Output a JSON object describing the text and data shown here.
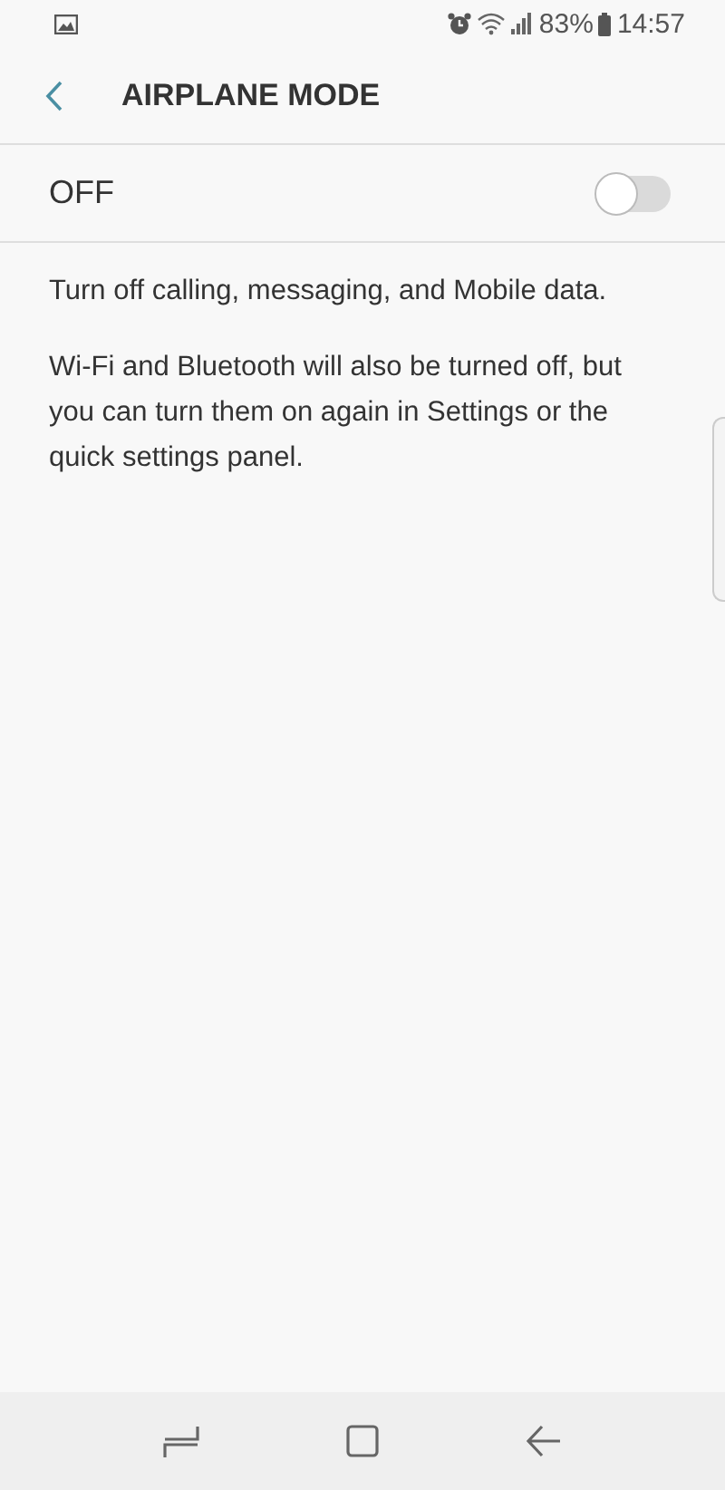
{
  "status_bar": {
    "battery": "83%",
    "time": "14:57"
  },
  "header": {
    "title": "AIRPLANE MODE"
  },
  "master_switch": {
    "label": "OFF",
    "on": false
  },
  "description": [
    "Turn off calling, messaging, and Mobile data.",
    "Wi-Fi and Bluetooth will also be turned off, but you can turn them on again in Settings or the quick settings panel."
  ]
}
